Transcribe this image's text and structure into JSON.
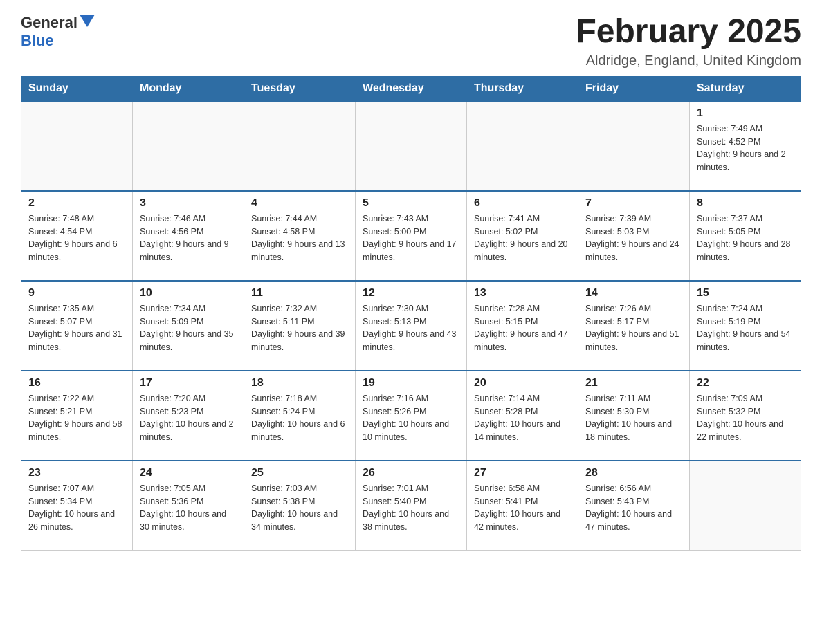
{
  "header": {
    "logo_general": "General",
    "logo_blue": "Blue",
    "title": "February 2025",
    "subtitle": "Aldridge, England, United Kingdom"
  },
  "days_of_week": [
    "Sunday",
    "Monday",
    "Tuesday",
    "Wednesday",
    "Thursday",
    "Friday",
    "Saturday"
  ],
  "weeks": [
    {
      "cells": [
        {
          "day": "",
          "info": ""
        },
        {
          "day": "",
          "info": ""
        },
        {
          "day": "",
          "info": ""
        },
        {
          "day": "",
          "info": ""
        },
        {
          "day": "",
          "info": ""
        },
        {
          "day": "",
          "info": ""
        },
        {
          "day": "1",
          "info": "Sunrise: 7:49 AM\nSunset: 4:52 PM\nDaylight: 9 hours and 2 minutes."
        }
      ]
    },
    {
      "cells": [
        {
          "day": "2",
          "info": "Sunrise: 7:48 AM\nSunset: 4:54 PM\nDaylight: 9 hours and 6 minutes."
        },
        {
          "day": "3",
          "info": "Sunrise: 7:46 AM\nSunset: 4:56 PM\nDaylight: 9 hours and 9 minutes."
        },
        {
          "day": "4",
          "info": "Sunrise: 7:44 AM\nSunset: 4:58 PM\nDaylight: 9 hours and 13 minutes."
        },
        {
          "day": "5",
          "info": "Sunrise: 7:43 AM\nSunset: 5:00 PM\nDaylight: 9 hours and 17 minutes."
        },
        {
          "day": "6",
          "info": "Sunrise: 7:41 AM\nSunset: 5:02 PM\nDaylight: 9 hours and 20 minutes."
        },
        {
          "day": "7",
          "info": "Sunrise: 7:39 AM\nSunset: 5:03 PM\nDaylight: 9 hours and 24 minutes."
        },
        {
          "day": "8",
          "info": "Sunrise: 7:37 AM\nSunset: 5:05 PM\nDaylight: 9 hours and 28 minutes."
        }
      ]
    },
    {
      "cells": [
        {
          "day": "9",
          "info": "Sunrise: 7:35 AM\nSunset: 5:07 PM\nDaylight: 9 hours and 31 minutes."
        },
        {
          "day": "10",
          "info": "Sunrise: 7:34 AM\nSunset: 5:09 PM\nDaylight: 9 hours and 35 minutes."
        },
        {
          "day": "11",
          "info": "Sunrise: 7:32 AM\nSunset: 5:11 PM\nDaylight: 9 hours and 39 minutes."
        },
        {
          "day": "12",
          "info": "Sunrise: 7:30 AM\nSunset: 5:13 PM\nDaylight: 9 hours and 43 minutes."
        },
        {
          "day": "13",
          "info": "Sunrise: 7:28 AM\nSunset: 5:15 PM\nDaylight: 9 hours and 47 minutes."
        },
        {
          "day": "14",
          "info": "Sunrise: 7:26 AM\nSunset: 5:17 PM\nDaylight: 9 hours and 51 minutes."
        },
        {
          "day": "15",
          "info": "Sunrise: 7:24 AM\nSunset: 5:19 PM\nDaylight: 9 hours and 54 minutes."
        }
      ]
    },
    {
      "cells": [
        {
          "day": "16",
          "info": "Sunrise: 7:22 AM\nSunset: 5:21 PM\nDaylight: 9 hours and 58 minutes."
        },
        {
          "day": "17",
          "info": "Sunrise: 7:20 AM\nSunset: 5:23 PM\nDaylight: 10 hours and 2 minutes."
        },
        {
          "day": "18",
          "info": "Sunrise: 7:18 AM\nSunset: 5:24 PM\nDaylight: 10 hours and 6 minutes."
        },
        {
          "day": "19",
          "info": "Sunrise: 7:16 AM\nSunset: 5:26 PM\nDaylight: 10 hours and 10 minutes."
        },
        {
          "day": "20",
          "info": "Sunrise: 7:14 AM\nSunset: 5:28 PM\nDaylight: 10 hours and 14 minutes."
        },
        {
          "day": "21",
          "info": "Sunrise: 7:11 AM\nSunset: 5:30 PM\nDaylight: 10 hours and 18 minutes."
        },
        {
          "day": "22",
          "info": "Sunrise: 7:09 AM\nSunset: 5:32 PM\nDaylight: 10 hours and 22 minutes."
        }
      ]
    },
    {
      "cells": [
        {
          "day": "23",
          "info": "Sunrise: 7:07 AM\nSunset: 5:34 PM\nDaylight: 10 hours and 26 minutes."
        },
        {
          "day": "24",
          "info": "Sunrise: 7:05 AM\nSunset: 5:36 PM\nDaylight: 10 hours and 30 minutes."
        },
        {
          "day": "25",
          "info": "Sunrise: 7:03 AM\nSunset: 5:38 PM\nDaylight: 10 hours and 34 minutes."
        },
        {
          "day": "26",
          "info": "Sunrise: 7:01 AM\nSunset: 5:40 PM\nDaylight: 10 hours and 38 minutes."
        },
        {
          "day": "27",
          "info": "Sunrise: 6:58 AM\nSunset: 5:41 PM\nDaylight: 10 hours and 42 minutes."
        },
        {
          "day": "28",
          "info": "Sunrise: 6:56 AM\nSunset: 5:43 PM\nDaylight: 10 hours and 47 minutes."
        },
        {
          "day": "",
          "info": ""
        }
      ]
    }
  ]
}
